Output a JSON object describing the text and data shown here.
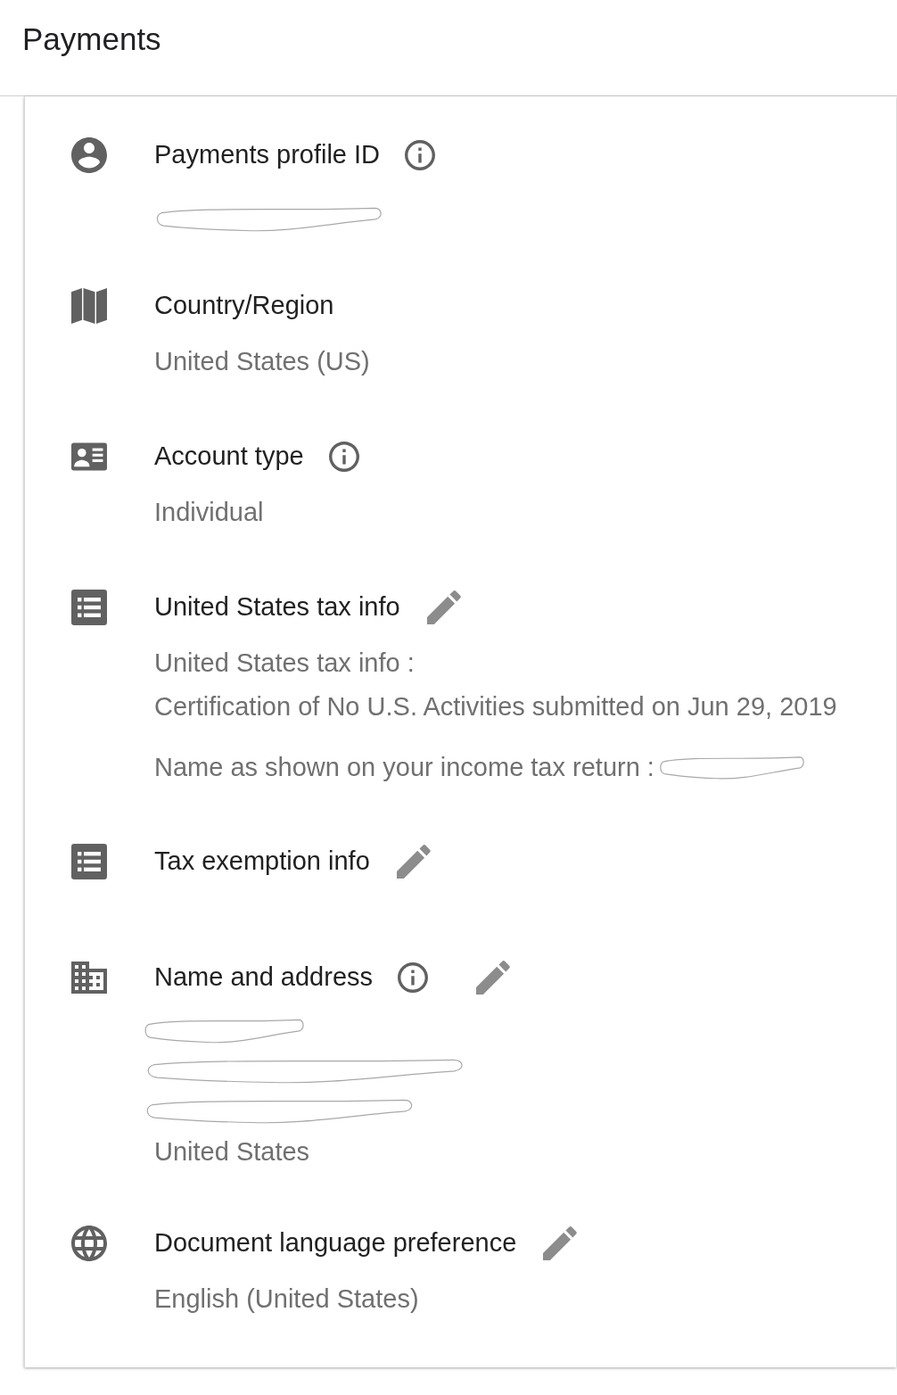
{
  "header": {
    "title": "Payments"
  },
  "sections": [
    {
      "title": "Payments profile ID",
      "info": true,
      "editable": false,
      "paragraphs": [
        [
          {
            "kind": "redacted"
          }
        ]
      ]
    },
    {
      "title": "Country/Region",
      "info": false,
      "editable": false,
      "paragraphs": [
        [
          {
            "kind": "text",
            "text": "United States (US)"
          }
        ]
      ]
    },
    {
      "title": "Account type",
      "info": true,
      "editable": false,
      "paragraphs": [
        [
          {
            "kind": "text",
            "text": "Individual"
          }
        ]
      ]
    },
    {
      "title": "United States tax info",
      "info": false,
      "editable": true,
      "paragraphs": [
        [
          {
            "kind": "text",
            "text": "United States tax info :"
          },
          {
            "kind": "text",
            "text": "Certification of No U.S. Activities submitted on Jun 29, 2019"
          }
        ],
        [
          {
            "kind": "text_redacted",
            "text": "Name as shown on your income tax return :"
          }
        ]
      ]
    },
    {
      "title": "Tax exemption info",
      "info": false,
      "editable": true
    },
    {
      "title": "Name and address",
      "info": true,
      "editable": true,
      "paragraphs": [
        [
          {
            "kind": "redacted"
          },
          {
            "kind": "redacted"
          },
          {
            "kind": "redacted"
          },
          {
            "kind": "text",
            "text": "United States"
          }
        ]
      ]
    },
    {
      "title": "Document language preference",
      "info": false,
      "editable": true,
      "paragraphs": [
        [
          {
            "kind": "text",
            "text": "English (United States)"
          }
        ]
      ]
    }
  ]
}
